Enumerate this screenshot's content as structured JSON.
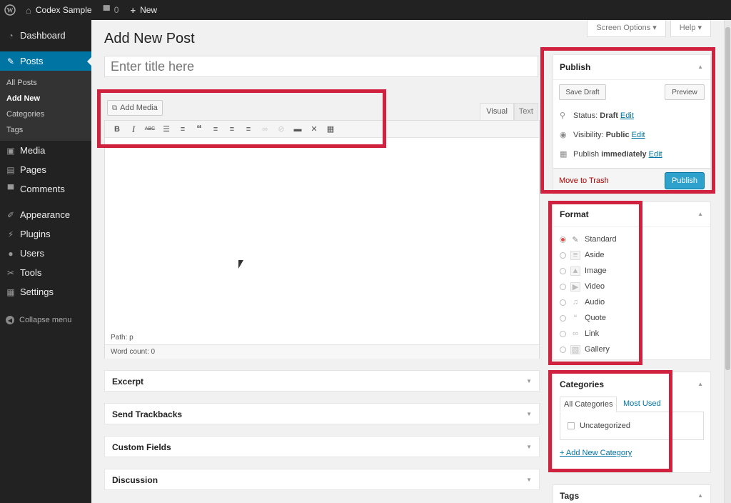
{
  "adminbar": {
    "site_name": "Codex Sample",
    "comments_count": "0",
    "new_label": "New"
  },
  "sidebar": {
    "items": [
      {
        "label": "Dashboard",
        "icon": "dashboard-icon"
      },
      {
        "label": "Posts",
        "icon": "pushpin-icon"
      },
      {
        "label": "Media",
        "icon": "media-icon"
      },
      {
        "label": "Pages",
        "icon": "pages-icon"
      },
      {
        "label": "Comments",
        "icon": "comment-icon"
      },
      {
        "label": "Appearance",
        "icon": "brush-icon"
      },
      {
        "label": "Plugins",
        "icon": "plugin-icon"
      },
      {
        "label": "Users",
        "icon": "user-icon"
      },
      {
        "label": "Tools",
        "icon": "wrench-icon"
      },
      {
        "label": "Settings",
        "icon": "settings-icon"
      }
    ],
    "posts_submenu": [
      "All Posts",
      "Add New",
      "Categories",
      "Tags"
    ],
    "collapse_label": "Collapse menu"
  },
  "screen_options": {
    "label": "Screen Options",
    "help": "Help"
  },
  "page_title": "Add New Post",
  "title_input": {
    "placeholder": "Enter title here"
  },
  "editor": {
    "add_media_label": "Add Media",
    "tab_visual": "Visual",
    "tab_text": "Text",
    "toolbar": [
      "bold",
      "italic",
      "strikethrough",
      "bullet-list",
      "numbered-list",
      "blockquote",
      "align-left",
      "align-center",
      "align-right",
      "link",
      "unlink",
      "read-more",
      "fullscreen",
      "toolbar-toggle"
    ],
    "path_label": "Path: p",
    "word_count": "Word count: 0"
  },
  "metaboxes": [
    "Excerpt",
    "Send Trackbacks",
    "Custom Fields",
    "Discussion"
  ],
  "publish": {
    "title": "Publish",
    "save_draft": "Save Draft",
    "preview": "Preview",
    "status_label": "Status:",
    "status_value": "Draft",
    "visibility_label": "Visibility:",
    "visibility_value": "Public",
    "publish_label": "Publish",
    "publish_value": "immediately",
    "edit": "Edit",
    "trash": "Move to Trash",
    "publish_button": "Publish"
  },
  "format": {
    "title": "Format",
    "options": [
      {
        "label": "Standard",
        "icon": "pushpin-icon",
        "selected": true
      },
      {
        "label": "Aside",
        "icon": "aside-icon",
        "selected": false
      },
      {
        "label": "Image",
        "icon": "image-icon",
        "selected": false
      },
      {
        "label": "Video",
        "icon": "video-icon",
        "selected": false
      },
      {
        "label": "Audio",
        "icon": "audio-icon",
        "selected": false
      },
      {
        "label": "Quote",
        "icon": "quote-icon",
        "selected": false
      },
      {
        "label": "Link",
        "icon": "link-icon",
        "selected": false
      },
      {
        "label": "Gallery",
        "icon": "gallery-icon",
        "selected": false
      }
    ]
  },
  "categories": {
    "title": "Categories",
    "tab_all": "All Categories",
    "tab_used": "Most Used",
    "items": [
      "Uncategorized"
    ],
    "add_new": "+ Add New Category"
  },
  "tags": {
    "title": "Tags"
  },
  "colors": {
    "highlight": "#d0213e",
    "accent": "#0074a2",
    "primary_button": "#2ea2cc"
  }
}
